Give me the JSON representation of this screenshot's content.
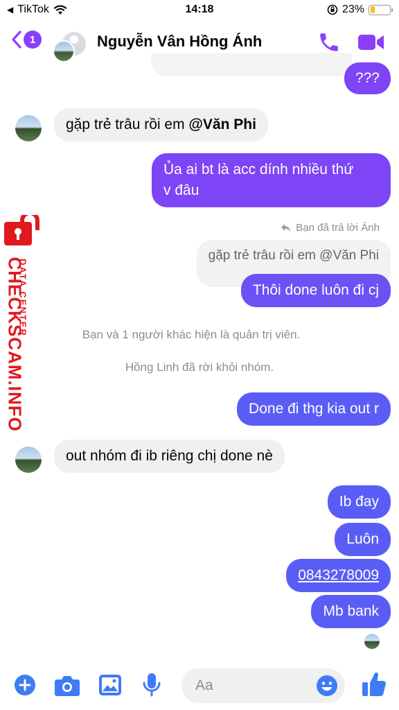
{
  "status_bar": {
    "app": "TikTok",
    "time": "14:18",
    "battery": "23%",
    "battery_level": 0.23
  },
  "header": {
    "back_badge": "1",
    "title": "Nguyễn Vân Hồng Ánh"
  },
  "messages": {
    "m1": "???",
    "m2_text": "gặp trẻ trâu rồi em ",
    "m2_mention": "@Văn Phi",
    "m3_line1": "Ủa ai bt là acc dính nhiều thứ",
    "m3_line2": "v đâu",
    "reply_note": "Bạn đã trả lời Ánh",
    "quoted": "gặp trẻ trâu rồi em @Văn Phi",
    "m4": "Thôi done luôn đi cj",
    "sys1": "Bạn và 1 người khác hiện là quản trị viên.",
    "sys2": "Hồng Linh đã rời khỏi nhóm.",
    "m5": "Done đi thg kia out r",
    "m6": "out nhóm đi ib riêng chị done nè",
    "m7": "Ib đay",
    "m8": "Luôn",
    "m9": "0843278009",
    "m10": "Mb bank"
  },
  "watermark": {
    "brand": "CHECKSCAM.INFO",
    "sub": "DATA CENTER"
  },
  "composer": {
    "placeholder": "Aa"
  },
  "colors": {
    "accent": "#8b3ffb",
    "outgoing": "#7d45f5",
    "outgoing_bottom": "#5a5df5",
    "incoming": "#f0f0f0",
    "watermark": "#e0191e"
  }
}
